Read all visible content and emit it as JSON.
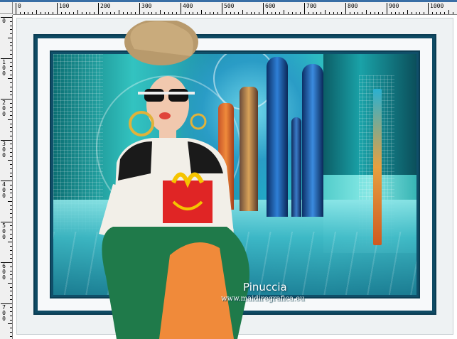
{
  "ruler": {
    "horizontal_labels": [
      "0",
      "100",
      "200",
      "300",
      "400",
      "500",
      "600",
      "700",
      "800",
      "900",
      "1000"
    ],
    "vertical_labels": [
      "0",
      "100",
      "200",
      "300",
      "400",
      "500",
      "600",
      "700"
    ]
  },
  "image": {
    "credit_name": "Pinuccia",
    "credit_url": "www.maidiregrafica.eu"
  },
  "colors": {
    "frame_teal": "#0e4a63",
    "accent_cyan": "#33c3c0"
  }
}
